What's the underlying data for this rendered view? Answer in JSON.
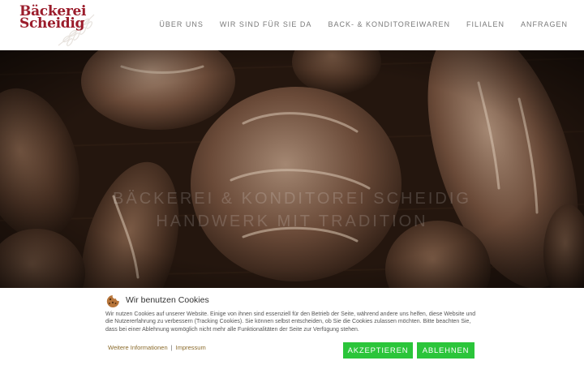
{
  "brand": {
    "line1": "Bäckerei",
    "line2": "Scheidig",
    "color": "#9b1c2b"
  },
  "nav": {
    "items": [
      {
        "label": "ÜBER UNS"
      },
      {
        "label": "WIR SIND FÜR SIE DA"
      },
      {
        "label": "BACK- & KONDITOREIWAREN"
      },
      {
        "label": "FILIALEN"
      },
      {
        "label": "ANFRAGEN"
      }
    ]
  },
  "hero": {
    "line1": "BÄCKEREI & KONDITOREI SCHEIDIG",
    "line2": "HANDWERK MIT TRADITION"
  },
  "cookie": {
    "icon": "cookie-icon",
    "title": "Wir benutzen Cookies",
    "text": "Wir nutzen Cookies auf unserer Website. Einige von ihnen sind essenziell für den Betrieb der Seite, während andere uns helfen, diese Website und die Nutzererfahrung zu verbessern (Tracking Cookies). Sie können selbst entscheiden, ob Sie die Cookies zulassen möchten. Bitte beachten Sie, dass bei einer Ablehnung womöglich nicht mehr alle Funktionalitäten der Seite zur Verfügung stehen.",
    "link_more": "Weitere Informationen",
    "separator": "|",
    "link_imprint": "Impressum",
    "accept_label": "AKZEPTIEREN",
    "decline_label": "ABLEHNEN",
    "button_color": "#2bc53a"
  }
}
